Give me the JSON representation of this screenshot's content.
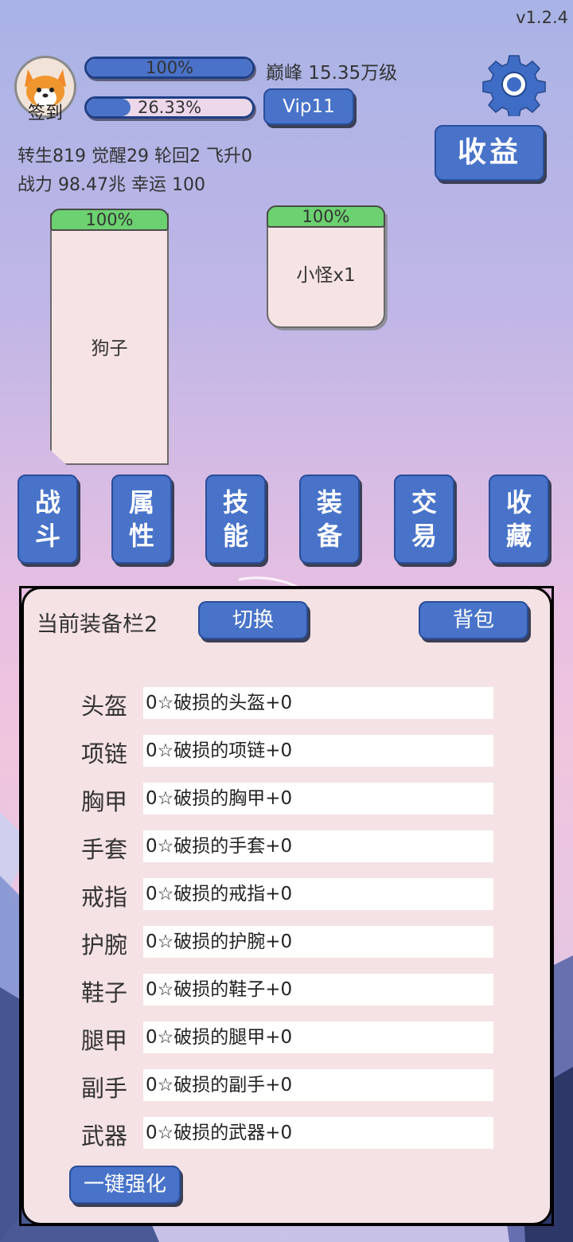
{
  "version": "v1.2.4",
  "player": {
    "checkin_label": "签到",
    "exp_bar": {
      "fill_percent": 100,
      "text": "100%"
    },
    "level_label": "巅峰 15.35万级",
    "vip_bar": {
      "fill_percent": 26.33,
      "text": "26.33%"
    },
    "vip_button": "Vip11",
    "stats_line1": "转生819 觉醒29 轮回2 飞升0",
    "stats_line2": "战力 98.47兆  幸运 100"
  },
  "top_actions": {
    "settings_icon": "gear-icon",
    "income_button": "收益"
  },
  "battle": {
    "player_card": {
      "hp_text": "100%",
      "hp_percent": 100,
      "name": "狗子"
    },
    "enemy_card": {
      "hp_text": "100%",
      "hp_percent": 100,
      "name": "小怪x1"
    }
  },
  "nav": [
    {
      "id": "battle",
      "label_top": "战",
      "label_bottom": "斗"
    },
    {
      "id": "attributes",
      "label_top": "属",
      "label_bottom": "性"
    },
    {
      "id": "skills",
      "label_top": "技",
      "label_bottom": "能"
    },
    {
      "id": "equipment",
      "label_top": "装",
      "label_bottom": "备"
    },
    {
      "id": "trade",
      "label_top": "交",
      "label_bottom": "易"
    },
    {
      "id": "collection",
      "label_top": "收",
      "label_bottom": "藏"
    }
  ],
  "equipment": {
    "title": "当前装备栏2",
    "switch_button": "切换",
    "bag_button": "背包",
    "slots": [
      {
        "label": "头盔",
        "value": "0☆破损的头盔+0"
      },
      {
        "label": "项链",
        "value": "0☆破损的项链+0"
      },
      {
        "label": "胸甲",
        "value": "0☆破损的胸甲+0"
      },
      {
        "label": "手套",
        "value": "0☆破损的手套+0"
      },
      {
        "label": "戒指",
        "value": "0☆破损的戒指+0"
      },
      {
        "label": "护腕",
        "value": "0☆破损的护腕+0"
      },
      {
        "label": "鞋子",
        "value": "0☆破损的鞋子+0"
      },
      {
        "label": "腿甲",
        "value": "0☆破损的腿甲+0"
      },
      {
        "label": "副手",
        "value": "0☆破损的副手+0"
      },
      {
        "label": "武器",
        "value": "0☆破损的武器+0"
      }
    ],
    "enhance_button": "一键强化"
  },
  "colors": {
    "button_blue": "#4873c9",
    "hp_green": "#6cd170",
    "panel_bg": "#f5e2e4"
  }
}
